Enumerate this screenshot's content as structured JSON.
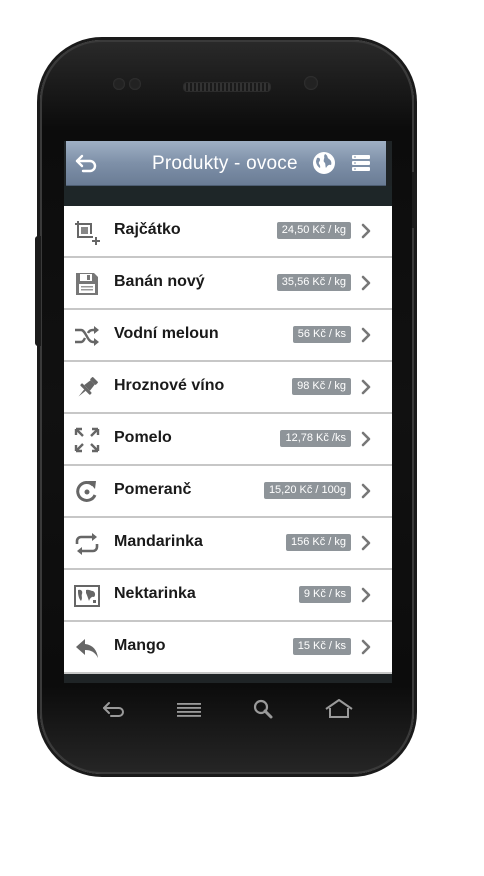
{
  "header": {
    "title": "Produkty - ovoce",
    "back_icon": "back-arrow-icon",
    "globe_icon": "globe-icon",
    "menu_icon": "menu-icon",
    "color": "#7e90a8"
  },
  "products": [
    {
      "name": "Rajčátko",
      "price": "24,50 Kč / kg",
      "icon": "crop-add-icon"
    },
    {
      "name": "Banán nový",
      "price": "35,56 Kč / kg",
      "icon": "save-icon"
    },
    {
      "name": "Vodní meloun",
      "price": "56 Kč / ks",
      "icon": "shuffle-icon"
    },
    {
      "name": "Hroznové víno",
      "price": "98 Kč / kg",
      "icon": "pin-icon"
    },
    {
      "name": "Pomelo",
      "price": "12,78 Kč /ks",
      "icon": "expand-icon"
    },
    {
      "name": "Pomeranč",
      "price": "15,20 Kč / 100g",
      "icon": "refresh-icon"
    },
    {
      "name": "Mandarinka",
      "price": "156 Kč / kg",
      "icon": "repeat-icon"
    },
    {
      "name": "Nektarinka",
      "price": "9 Kč / ks",
      "icon": "map-icon"
    },
    {
      "name": "Mango",
      "price": "15 Kč / ks",
      "icon": "reply-icon"
    }
  ],
  "navbar": {
    "icons": [
      "back-icon",
      "menu-icon",
      "search-icon",
      "home-icon"
    ]
  },
  "colors": {
    "price_badge": "#8e9499",
    "row_divider": "#c7c7c7"
  }
}
